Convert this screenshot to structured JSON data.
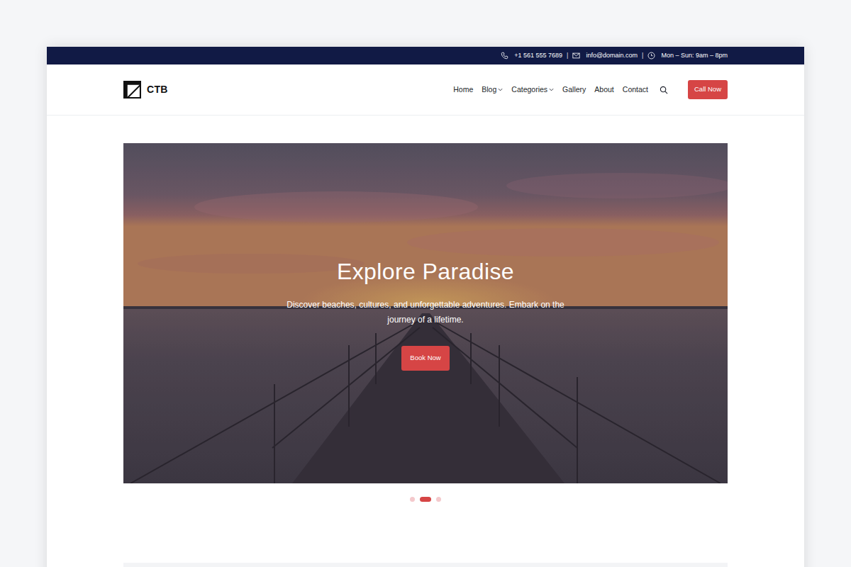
{
  "topbar": {
    "phone": "+1 561 555 7689",
    "email": "info@domain.com",
    "hours": "Mon – Sun: 9am – 8pm",
    "separator": "|"
  },
  "logo": {
    "text": "CTB"
  },
  "nav": {
    "items": [
      {
        "label": "Home",
        "dropdown": false
      },
      {
        "label": "Blog",
        "dropdown": true
      },
      {
        "label": "Categories",
        "dropdown": true
      },
      {
        "label": "Gallery",
        "dropdown": false
      },
      {
        "label": "About",
        "dropdown": false
      },
      {
        "label": "Contact",
        "dropdown": false
      }
    ]
  },
  "cta": {
    "label": "Call Now"
  },
  "hero": {
    "title": "Explore Paradise",
    "text": "Discover beaches, cultures, and unforgettable adventures. Embark on the journey of a lifetime.",
    "button": "Book Now"
  },
  "carousel": {
    "slides": [
      {
        "selected": false
      },
      {
        "selected": true
      },
      {
        "selected": false
      }
    ]
  }
}
